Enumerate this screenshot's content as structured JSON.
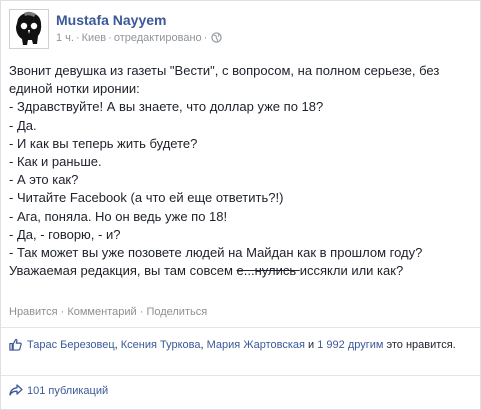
{
  "post": {
    "author": "Mustafa Nayyem",
    "meta": {
      "time": "1 ч.",
      "location": "Киев",
      "edited": "отредактировано"
    },
    "text_lines": [
      "Звонит девушка из газеты \"Вести\", с вопросом, на полном серьезе, без",
      "единой нотки иронии:",
      "- Здравствуйте! А вы знаете, что доллар уже по 18?",
      "- Да.",
      "- И как вы теперь жить будете?",
      "- Как и раньше.",
      "- А это как?",
      "- Читайте Facebook (а что ей еще ответить?!)",
      "- Ага, поняла. Но он ведь уже по 18!",
      "- Да, - говорю, - и?",
      "- Так может вы уже позовете людей на Майдан как в прошлом году?"
    ],
    "last_line": {
      "before": "Уважаемая редакция, вы там совсем",
      "struck": "е...нулись ",
      "after": "иссякли или как?"
    }
  },
  "actions": {
    "like": "Нравится",
    "comments": "Комментарий",
    "share": "Поделиться"
  },
  "likes": {
    "names": [
      "Тарас Березовец",
      "Ксения Туркова",
      "Мария Жартовская"
    ],
    "sep1": ", ",
    "sep2": ", ",
    "conj": " и ",
    "others": "1 992 другим",
    "suffix": " это нравится."
  },
  "shares": {
    "label": "101 публикаций"
  },
  "colors": {
    "link": "#3b5998",
    "text": "#1d2129",
    "muted": "#90949c"
  },
  "icons": [
    "avatar-skull-icon",
    "globe-icon",
    "thumbs-up-icon",
    "share-arrow-icon"
  ]
}
